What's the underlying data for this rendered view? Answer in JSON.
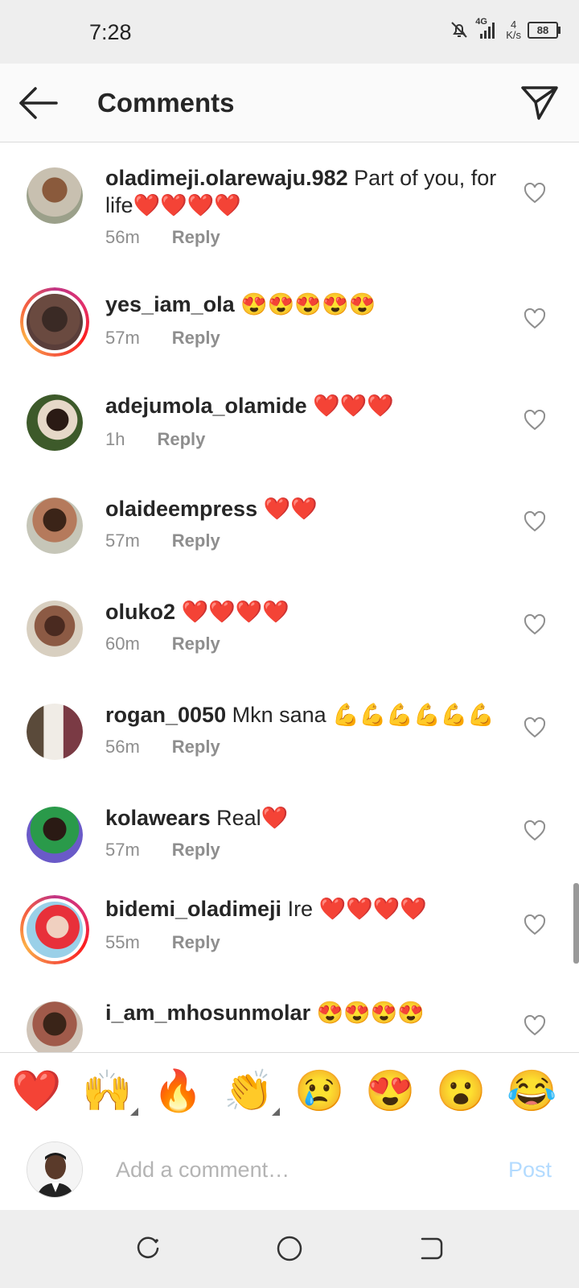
{
  "status_bar": {
    "time": "7:28",
    "net_type": "4G",
    "speed_value": "4",
    "speed_unit": "K/s",
    "battery": "88"
  },
  "header": {
    "title": "Comments"
  },
  "comments": [
    {
      "username": "oladimeji.olarewaju.982",
      "text": " Part of you, for life❤️❤️❤️❤️",
      "time": "56m",
      "reply": "Reply"
    },
    {
      "username": "yes_iam_ola",
      "text": " 😍😍😍😍😍",
      "time": "57m",
      "reply": "Reply"
    },
    {
      "username": "adejumola_olamide",
      "text": " ❤️❤️❤️",
      "time": "1h",
      "reply": "Reply"
    },
    {
      "username": "olaideempress",
      "text": " ❤️❤️",
      "time": "57m",
      "reply": "Reply"
    },
    {
      "username": "oluko2",
      "text": " ❤️❤️❤️❤️",
      "time": "60m",
      "reply": "Reply"
    },
    {
      "username": "rogan_0050",
      "text": " Mkn sana 💪💪💪💪💪💪",
      "time": "56m",
      "reply": "Reply"
    },
    {
      "username": "kolawears",
      "text": " Real❤️",
      "time": "57m",
      "reply": "Reply"
    },
    {
      "username": "bidemi_oladimeji",
      "text": " Ire ❤️❤️❤️❤️",
      "time": "55m",
      "reply": "Reply"
    },
    {
      "username": "i_am_mhosunmolar",
      "text": " 😍😍😍😍",
      "time": "",
      "reply": ""
    }
  ],
  "emoji_bar": [
    "❤️",
    "🙌",
    "🔥",
    "👏",
    "😢",
    "😍",
    "😮",
    "😂"
  ],
  "compose": {
    "placeholder": "Add a comment…",
    "post_label": "Post"
  },
  "colors": {
    "heart": "#ed4956",
    "post_disabled": "#b3dbff",
    "meta": "#8e8e8e"
  }
}
